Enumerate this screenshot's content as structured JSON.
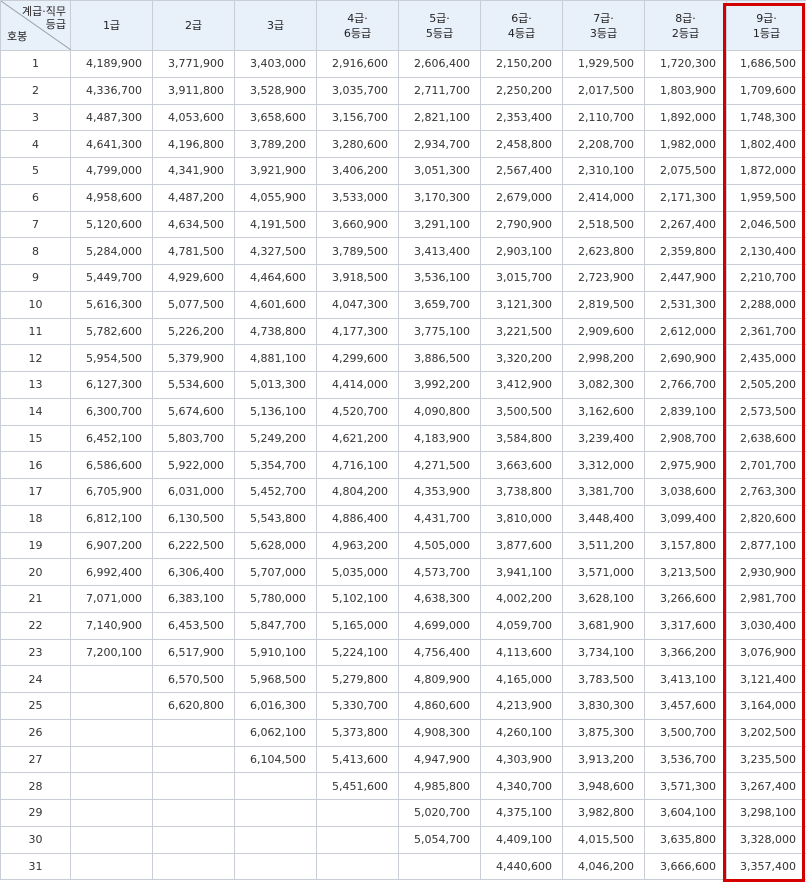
{
  "table": {
    "corner_top_line1": "계급·직무",
    "corner_top_line2": "등급",
    "corner_bottom": "호봉",
    "headers": [
      {
        "l1": "1급",
        "l2": ""
      },
      {
        "l1": "2급",
        "l2": ""
      },
      {
        "l1": "3급",
        "l2": ""
      },
      {
        "l1": "4급·",
        "l2": "6등급"
      },
      {
        "l1": "5급·",
        "l2": "5등급"
      },
      {
        "l1": "6급·",
        "l2": "4등급"
      },
      {
        "l1": "7급·",
        "l2": "3등급"
      },
      {
        "l1": "8급·",
        "l2": "2등급"
      },
      {
        "l1": "9급·",
        "l2": "1등급"
      }
    ],
    "rows": [
      [
        "1",
        "4,189,900",
        "3,771,900",
        "3,403,000",
        "2,916,600",
        "2,606,400",
        "2,150,200",
        "1,929,500",
        "1,720,300",
        "1,686,500"
      ],
      [
        "2",
        "4,336,700",
        "3,911,800",
        "3,528,900",
        "3,035,700",
        "2,711,700",
        "2,250,200",
        "2,017,500",
        "1,803,900",
        "1,709,600"
      ],
      [
        "3",
        "4,487,300",
        "4,053,600",
        "3,658,600",
        "3,156,700",
        "2,821,100",
        "2,353,400",
        "2,110,700",
        "1,892,000",
        "1,748,300"
      ],
      [
        "4",
        "4,641,300",
        "4,196,800",
        "3,789,200",
        "3,280,600",
        "2,934,700",
        "2,458,800",
        "2,208,700",
        "1,982,000",
        "1,802,400"
      ],
      [
        "5",
        "4,799,000",
        "4,341,900",
        "3,921,900",
        "3,406,200",
        "3,051,300",
        "2,567,400",
        "2,310,100",
        "2,075,500",
        "1,872,000"
      ],
      [
        "6",
        "4,958,600",
        "4,487,200",
        "4,055,900",
        "3,533,000",
        "3,170,300",
        "2,679,000",
        "2,414,000",
        "2,171,300",
        "1,959,500"
      ],
      [
        "7",
        "5,120,600",
        "4,634,500",
        "4,191,500",
        "3,660,900",
        "3,291,100",
        "2,790,900",
        "2,518,500",
        "2,267,400",
        "2,046,500"
      ],
      [
        "8",
        "5,284,000",
        "4,781,500",
        "4,327,500",
        "3,789,500",
        "3,413,400",
        "2,903,100",
        "2,623,800",
        "2,359,800",
        "2,130,400"
      ],
      [
        "9",
        "5,449,700",
        "4,929,600",
        "4,464,600",
        "3,918,500",
        "3,536,100",
        "3,015,700",
        "2,723,900",
        "2,447,900",
        "2,210,700"
      ],
      [
        "10",
        "5,616,300",
        "5,077,500",
        "4,601,600",
        "4,047,300",
        "3,659,700",
        "3,121,300",
        "2,819,500",
        "2,531,300",
        "2,288,000"
      ],
      [
        "11",
        "5,782,600",
        "5,226,200",
        "4,738,800",
        "4,177,300",
        "3,775,100",
        "3,221,500",
        "2,909,600",
        "2,612,000",
        "2,361,700"
      ],
      [
        "12",
        "5,954,500",
        "5,379,900",
        "4,881,100",
        "4,299,600",
        "3,886,500",
        "3,320,200",
        "2,998,200",
        "2,690,900",
        "2,435,000"
      ],
      [
        "13",
        "6,127,300",
        "5,534,600",
        "5,013,300",
        "4,414,000",
        "3,992,200",
        "3,412,900",
        "3,082,300",
        "2,766,700",
        "2,505,200"
      ],
      [
        "14",
        "6,300,700",
        "5,674,600",
        "5,136,100",
        "4,520,700",
        "4,090,800",
        "3,500,500",
        "3,162,600",
        "2,839,100",
        "2,573,500"
      ],
      [
        "15",
        "6,452,100",
        "5,803,700",
        "5,249,200",
        "4,621,200",
        "4,183,900",
        "3,584,800",
        "3,239,400",
        "2,908,700",
        "2,638,600"
      ],
      [
        "16",
        "6,586,600",
        "5,922,000",
        "5,354,700",
        "4,716,100",
        "4,271,500",
        "3,663,600",
        "3,312,000",
        "2,975,900",
        "2,701,700"
      ],
      [
        "17",
        "6,705,900",
        "6,031,000",
        "5,452,700",
        "4,804,200",
        "4,353,900",
        "3,738,800",
        "3,381,700",
        "3,038,600",
        "2,763,300"
      ],
      [
        "18",
        "6,812,100",
        "6,130,500",
        "5,543,800",
        "4,886,400",
        "4,431,700",
        "3,810,000",
        "3,448,400",
        "3,099,400",
        "2,820,600"
      ],
      [
        "19",
        "6,907,200",
        "6,222,500",
        "5,628,000",
        "4,963,200",
        "4,505,000",
        "3,877,600",
        "3,511,200",
        "3,157,800",
        "2,877,100"
      ],
      [
        "20",
        "6,992,400",
        "6,306,400",
        "5,707,000",
        "5,035,000",
        "4,573,700",
        "3,941,100",
        "3,571,000",
        "3,213,500",
        "2,930,900"
      ],
      [
        "21",
        "7,071,000",
        "6,383,100",
        "5,780,000",
        "5,102,100",
        "4,638,300",
        "4,002,200",
        "3,628,100",
        "3,266,600",
        "2,981,700"
      ],
      [
        "22",
        "7,140,900",
        "6,453,500",
        "5,847,700",
        "5,165,000",
        "4,699,000",
        "4,059,700",
        "3,681,900",
        "3,317,600",
        "3,030,400"
      ],
      [
        "23",
        "7,200,100",
        "6,517,900",
        "5,910,100",
        "5,224,100",
        "4,756,400",
        "4,113,600",
        "3,734,100",
        "3,366,200",
        "3,076,900"
      ],
      [
        "24",
        "",
        "6,570,500",
        "5,968,500",
        "5,279,800",
        "4,809,900",
        "4,165,000",
        "3,783,500",
        "3,413,100",
        "3,121,400"
      ],
      [
        "25",
        "",
        "6,620,800",
        "6,016,300",
        "5,330,700",
        "4,860,600",
        "4,213,900",
        "3,830,300",
        "3,457,600",
        "3,164,000"
      ],
      [
        "26",
        "",
        "",
        "6,062,100",
        "5,373,800",
        "4,908,300",
        "4,260,100",
        "3,875,300",
        "3,500,700",
        "3,202,500"
      ],
      [
        "27",
        "",
        "",
        "6,104,500",
        "5,413,600",
        "4,947,900",
        "4,303,900",
        "3,913,200",
        "3,536,700",
        "3,235,500"
      ],
      [
        "28",
        "",
        "",
        "",
        "5,451,600",
        "4,985,800",
        "4,340,700",
        "3,948,600",
        "3,571,300",
        "3,267,400"
      ],
      [
        "29",
        "",
        "",
        "",
        "",
        "5,020,700",
        "4,375,100",
        "3,982,800",
        "3,604,100",
        "3,298,100"
      ],
      [
        "30",
        "",
        "",
        "",
        "",
        "5,054,700",
        "4,409,100",
        "4,015,500",
        "3,635,800",
        "3,328,000"
      ],
      [
        "31",
        "",
        "",
        "",
        "",
        "",
        "4,440,600",
        "4,046,200",
        "3,666,600",
        "3,357,400"
      ]
    ],
    "highlight_color": "#d40000"
  }
}
